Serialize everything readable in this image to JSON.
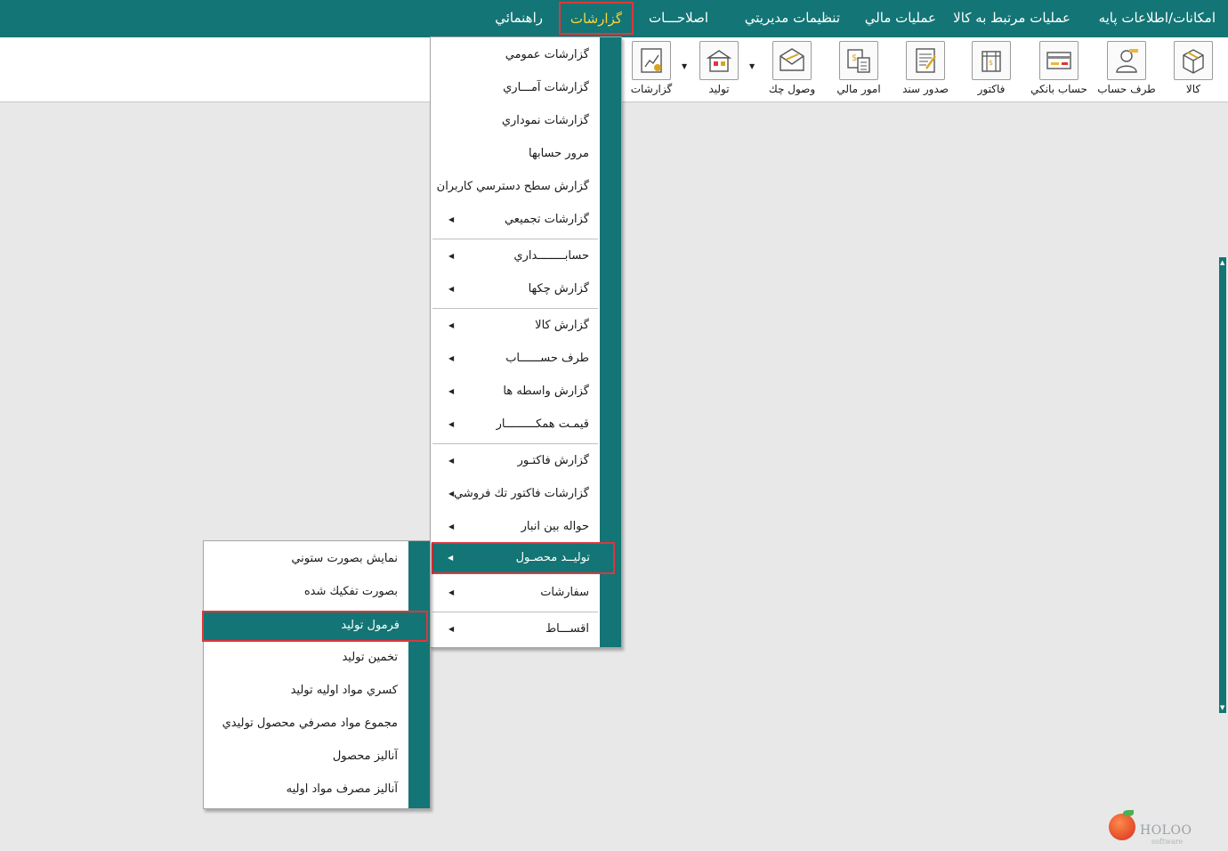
{
  "menubar": {
    "items": [
      {
        "label": "امکانات/اطلاعات پايه"
      },
      {
        "label": "عمليات مرتبط به کالا"
      },
      {
        "label": "عمليات مالي"
      },
      {
        "label": "تنظيمات مديريتي"
      },
      {
        "label": "اصلاحـــات"
      },
      {
        "label": "گزارشات"
      },
      {
        "label": "راهنمائي"
      }
    ]
  },
  "toolbar": {
    "buttons": [
      {
        "label": "کالا",
        "icon": "box-icon"
      },
      {
        "label": "طرف حساب",
        "icon": "person-icon"
      },
      {
        "label": "حساب بانکي",
        "icon": "bank-card-icon"
      },
      {
        "label": "فاکتور",
        "icon": "invoice-basket-icon"
      },
      {
        "label": "صدور سند",
        "icon": "document-pen-icon"
      },
      {
        "label": "امور مالي",
        "icon": "money-calculator-icon"
      },
      {
        "label": "وصول چك",
        "icon": "envelope-check-icon"
      },
      {
        "label": "توليد",
        "icon": "factory-icon"
      },
      {
        "label": "گزارشات",
        "icon": "report-chart-icon"
      }
    ]
  },
  "reports_menu": {
    "items": [
      {
        "label": "گزارشات عمومي"
      },
      {
        "label": "گزارشات آمـــاري"
      },
      {
        "label": "گزارشات نموداري"
      },
      {
        "label": "مرور حسابها"
      },
      {
        "label": "گزارش سطح دسترسي کاربران"
      },
      {
        "label": "گزارشات تجميعي"
      },
      {
        "label": "حسابــــــــداري"
      },
      {
        "label": "گزارش چکها"
      },
      {
        "label": "گزارش کالا"
      },
      {
        "label": "طرف حســــــاب"
      },
      {
        "label": "گزارش واسطه ها"
      },
      {
        "label": "قيمـت همکـــــــــار"
      },
      {
        "label": "گزارش فاکتـور"
      },
      {
        "label": "گزارشات فاکتور تك فروشي"
      },
      {
        "label": "حواله بين انبار"
      },
      {
        "label": "توليــد محصـول"
      },
      {
        "label": "سفارشات"
      },
      {
        "label": "اقســـاط"
      }
    ]
  },
  "production_submenu": {
    "items": [
      {
        "label": "نمايش بصورت ستوني"
      },
      {
        "label": "بصورت تفکيك شده"
      },
      {
        "label": "فرمول توليد"
      },
      {
        "label": "تخمين توليد"
      },
      {
        "label": "کسري مواد اوليه توليد"
      },
      {
        "label": "مجموع مواد مصرفي محصول توليدي"
      },
      {
        "label": "آناليز محصول"
      },
      {
        "label": "آناليز مصرف مواد اوليه"
      }
    ]
  },
  "logo": {
    "name": "HOLOO",
    "tagline": "software"
  },
  "colors": {
    "accent": "#137575",
    "highlight_border": "#e0363b",
    "active_menu_text": "#ffd43b"
  }
}
